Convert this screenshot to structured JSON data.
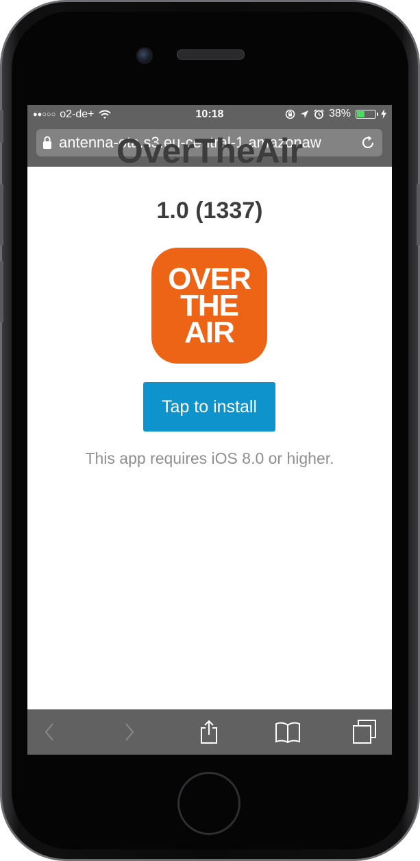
{
  "status_bar": {
    "signal_dots": "●●○○○",
    "carrier": "o2-de+",
    "time": "10:18",
    "battery_percent": "38%",
    "battery_level": 0.38,
    "battery_color": "#4cd964"
  },
  "browser": {
    "url": "antenna-ota.s3.eu-central-1.amazonaw",
    "icons": [
      "lock-icon",
      "reload-icon",
      "back-icon",
      "forward-icon",
      "share-icon",
      "bookmarks-icon",
      "tabs-icon"
    ]
  },
  "page": {
    "title": "OverTheAir",
    "version": "1.0 (1337)",
    "app_icon_lines": [
      "OVER",
      "THE",
      "AIR"
    ],
    "app_icon_color": "#ee6416",
    "install_button": "Tap to install",
    "install_button_color": "#0e93cc",
    "requirement": "This app requires iOS 8.0 or higher."
  }
}
